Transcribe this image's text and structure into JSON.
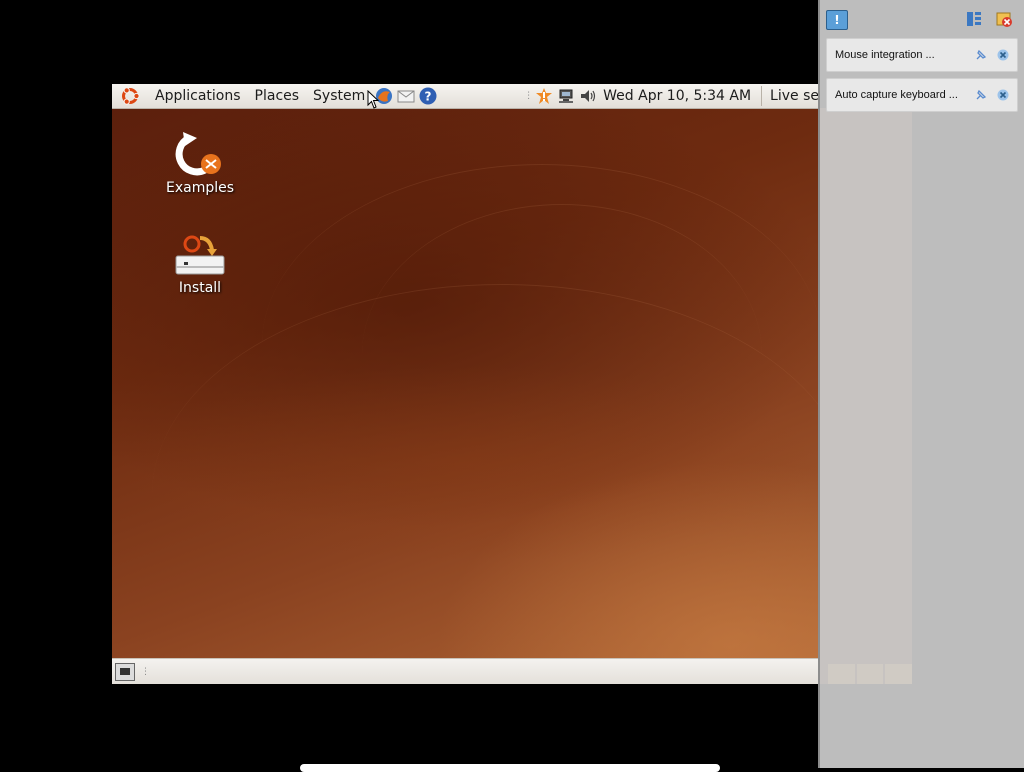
{
  "panel": {
    "menus": [
      "Applications",
      "Places",
      "System"
    ],
    "clock": "Wed Apr 10,  5:34 AM",
    "session": "Live se"
  },
  "desktop": {
    "icons": [
      {
        "label": "Examples",
        "icon": "examples-folder-icon"
      },
      {
        "label": "Install",
        "icon": "install-icon"
      }
    ]
  },
  "notifications": [
    {
      "text": "Mouse integration ..."
    },
    {
      "text": "Auto capture keyboard ..."
    }
  ],
  "colors": {
    "wallpaper": "#6e2b10",
    "panel": "#ece9e4",
    "sidebar": "#bdbdbd",
    "notify_accent": "#5b9fd8"
  }
}
